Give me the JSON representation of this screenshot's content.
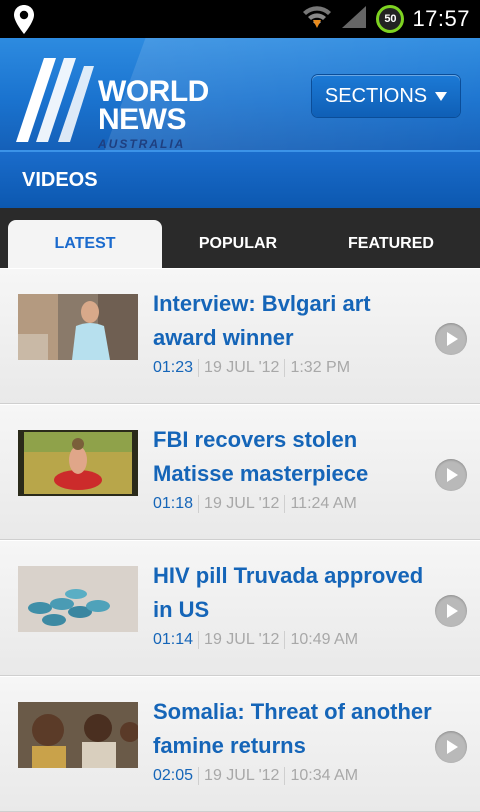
{
  "status_bar": {
    "time": "17:57",
    "battery_level": "50",
    "icons": [
      "location-pin-icon",
      "wifi-icon",
      "signal-icon",
      "battery-icon"
    ]
  },
  "header": {
    "logo_line1": "WORLD",
    "logo_line2": "NEWS",
    "logo_line3": "AUSTRALIA",
    "sections_label": "SECTIONS"
  },
  "section": {
    "title": "VIDEOS"
  },
  "tabs": [
    {
      "label": "LATEST",
      "active": true
    },
    {
      "label": "POPULAR",
      "active": false
    },
    {
      "label": "FEATURED",
      "active": false
    }
  ],
  "videos": [
    {
      "title": "Interview: Bvlgari art award winner",
      "duration": "01:23",
      "date": "19 JUL '12",
      "time": "1:32 PM"
    },
    {
      "title": "FBI recovers stolen Matisse masterpiece",
      "duration": "01:18",
      "date": "19 JUL '12",
      "time": "11:24 AM"
    },
    {
      "title": "HIV pill Truvada approved in US",
      "duration": "01:14",
      "date": "19 JUL '12",
      "time": "10:49 AM"
    },
    {
      "title": "Somalia: Threat of another famine returns",
      "duration": "02:05",
      "date": "19 JUL '12",
      "time": "10:34 AM"
    }
  ],
  "colors": {
    "accent": "#1565b8",
    "header_blue": "#1a73cf",
    "tab_bar": "#2a2a2a",
    "meta_gray": "#a8a8a8"
  }
}
